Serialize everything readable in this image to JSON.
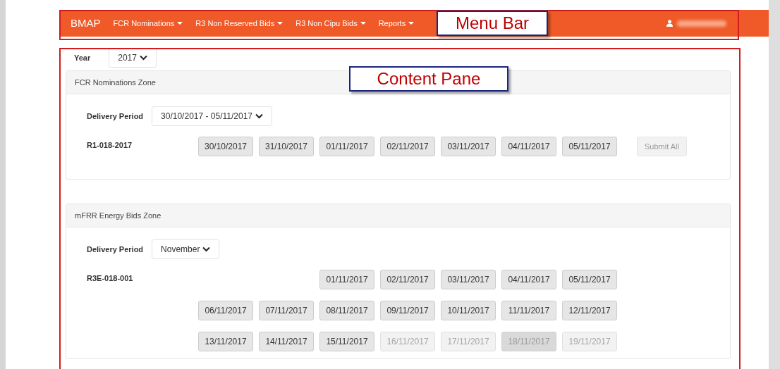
{
  "navbar": {
    "brand": "BMAP",
    "menus": [
      {
        "label": "FCR Nominations"
      },
      {
        "label": "R3 Non Reserved Bids"
      },
      {
        "label": "R3 Non Cipu Bids"
      },
      {
        "label": "Reports"
      }
    ]
  },
  "year": {
    "label": "Year",
    "value": "2017"
  },
  "zones": [
    {
      "title": "FCR Nominations Zone",
      "period_label": "Delivery Period",
      "period_value": "30/10/2017 - 05/11/2017",
      "code": "R1-018-2017",
      "weeks": [
        [
          {
            "date": "30/10/2017",
            "disabled": false,
            "selected": false
          },
          {
            "date": "31/10/2017",
            "disabled": false,
            "selected": false
          },
          {
            "date": "01/11/2017",
            "disabled": false,
            "selected": false
          },
          {
            "date": "02/11/2017",
            "disabled": false,
            "selected": false
          },
          {
            "date": "03/11/2017",
            "disabled": false,
            "selected": false
          },
          {
            "date": "04/11/2017",
            "disabled": false,
            "selected": false
          },
          {
            "date": "05/11/2017",
            "disabled": false,
            "selected": false
          }
        ]
      ],
      "submit": {
        "label": "Submit All",
        "disabled": true
      }
    },
    {
      "title": "mFRR Energy Bids Zone",
      "period_label": "Delivery Period",
      "period_value": "November",
      "code": "R3E-018-001",
      "weeks": [
        [
          {
            "date": "01/11/2017",
            "disabled": false,
            "selected": false
          },
          {
            "date": "02/11/2017",
            "disabled": false,
            "selected": false
          },
          {
            "date": "03/11/2017",
            "disabled": false,
            "selected": false
          },
          {
            "date": "04/11/2017",
            "disabled": false,
            "selected": false
          },
          {
            "date": "05/11/2017",
            "disabled": false,
            "selected": false
          }
        ],
        [
          {
            "date": "06/11/2017",
            "disabled": false,
            "selected": false
          },
          {
            "date": "07/11/2017",
            "disabled": false,
            "selected": false
          },
          {
            "date": "08/11/2017",
            "disabled": false,
            "selected": false
          },
          {
            "date": "09/11/2017",
            "disabled": false,
            "selected": false
          },
          {
            "date": "10/11/2017",
            "disabled": false,
            "selected": false
          },
          {
            "date": "11/11/2017",
            "disabled": false,
            "selected": false
          },
          {
            "date": "12/11/2017",
            "disabled": false,
            "selected": false
          }
        ],
        [
          {
            "date": "13/11/2017",
            "disabled": false,
            "selected": false
          },
          {
            "date": "14/11/2017",
            "disabled": false,
            "selected": false
          },
          {
            "date": "15/11/2017",
            "disabled": false,
            "selected": false
          },
          {
            "date": "16/11/2017",
            "disabled": true,
            "selected": false
          },
          {
            "date": "17/11/2017",
            "disabled": true,
            "selected": false
          },
          {
            "date": "18/11/2017",
            "disabled": true,
            "selected": true
          },
          {
            "date": "19/11/2017",
            "disabled": true,
            "selected": false
          }
        ]
      ]
    }
  ],
  "annotations": [
    {
      "label": "Menu Bar"
    },
    {
      "label": "Content Pane"
    }
  ]
}
